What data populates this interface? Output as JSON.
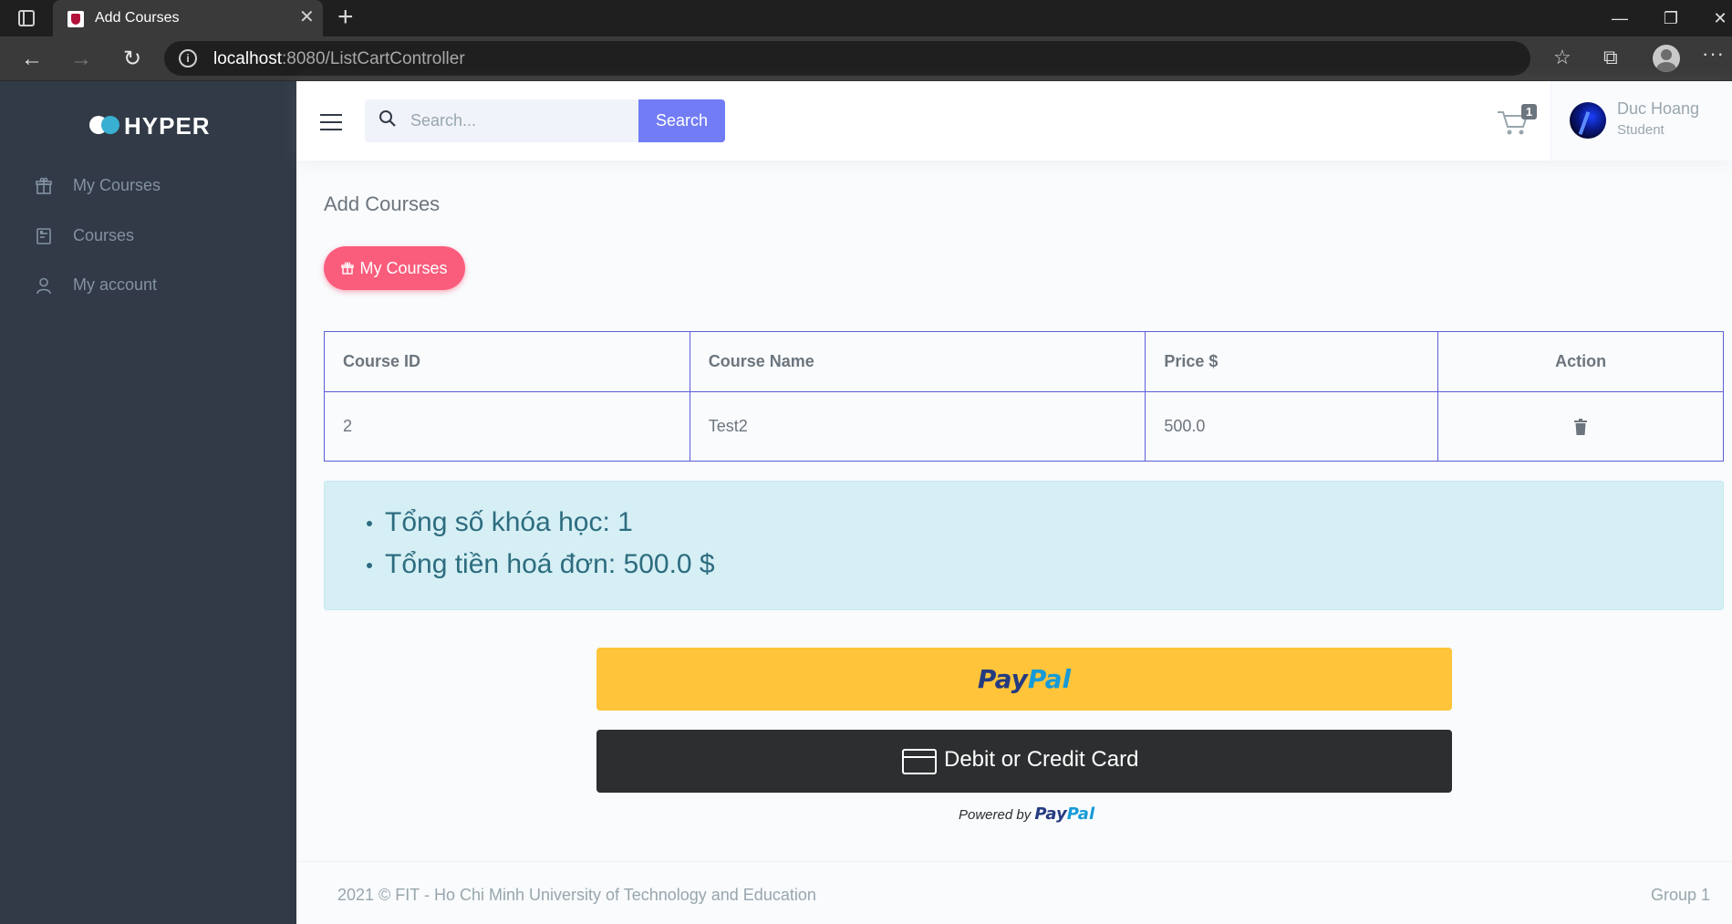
{
  "browser": {
    "tab_title": "Add Courses",
    "url_host": "localhost",
    "url_rest": ":8080/ListCartController"
  },
  "sidebar": {
    "logo_text": "HYPER",
    "items": [
      {
        "label": "My Courses",
        "icon": "gift-icon"
      },
      {
        "label": "Courses",
        "icon": "document-icon"
      },
      {
        "label": "My account",
        "icon": "user-icon"
      }
    ]
  },
  "topbar": {
    "search_placeholder": "Search...",
    "search_button": "Search",
    "cart_count": "1",
    "user_name": "Duc Hoang",
    "user_role": "Student"
  },
  "main": {
    "page_title": "Add Courses",
    "my_courses_button": "My Courses",
    "table": {
      "headers": [
        "Course ID",
        "Course Name",
        "Price $",
        "Action"
      ],
      "rows": [
        {
          "course_id": "2",
          "course_name": "Test2",
          "price": "500.0"
        }
      ]
    },
    "summary": [
      "Tổng số khóa học: 1",
      "Tổng tiền hoá đơn: 500.0 $"
    ],
    "paypal": {
      "logo_pay": "Pay",
      "logo_pal": "Pal",
      "card_button": "Debit or Credit Card",
      "powered_by": "Powered by"
    }
  },
  "footer": {
    "left": "2021 © FIT - Ho Chi Minh University of Technology and Education",
    "right": "Group 1"
  },
  "colors": {
    "sidebar_bg": "#313a46",
    "accent": "#727cf5",
    "danger": "#fa5c7c",
    "info_bg": "#d5eff5",
    "paypal_yellow": "#ffc439"
  }
}
